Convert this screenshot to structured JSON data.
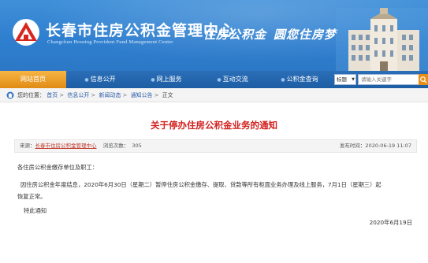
{
  "header": {
    "title": "长春市住房公积金管理中心",
    "subtitle": "Changchun Housing Provident Fund Management Center",
    "slogan_1": "住房公积金",
    "slogan_2": "圆您住房梦"
  },
  "nav": {
    "items": [
      {
        "label": "网站首页",
        "active": true
      },
      {
        "label": "信息公开"
      },
      {
        "label": "网上服务"
      },
      {
        "label": "互动交流"
      },
      {
        "label": "公积金查询"
      }
    ],
    "select_value": "标题",
    "search_placeholder": "请输入关键字"
  },
  "breadcrumb": {
    "prefix": "您的位置：",
    "items": [
      "首页",
      "信息公开",
      "新闻动态",
      "通知公告",
      "正文"
    ],
    "separator": ">"
  },
  "article": {
    "title": "关于停办住房公积金业务的通知",
    "meta_source_label": "来源：",
    "meta_source": "长春市住房公积金管理中心",
    "meta_views_label": "浏览次数：",
    "meta_views": "305",
    "meta_time_label": "发布时间：",
    "meta_time": "2020-06-19 11:07",
    "greeting": "各住房公积金缴存单位及职工：",
    "para_line1": "因住房公积金年度结息，2020年6月30日（星期二）暂停住房公积金缴存、提取、贷款等所有柜面业务办理及线上服务，7月1日（星期三）起",
    "para_line2": "恢复正常。",
    "closing": "特此通知",
    "date": "2020年6月19日"
  },
  "colors": {
    "nav_active": "#f0a030",
    "title_red": "#d2201e",
    "header_blue": "#3487d4"
  }
}
